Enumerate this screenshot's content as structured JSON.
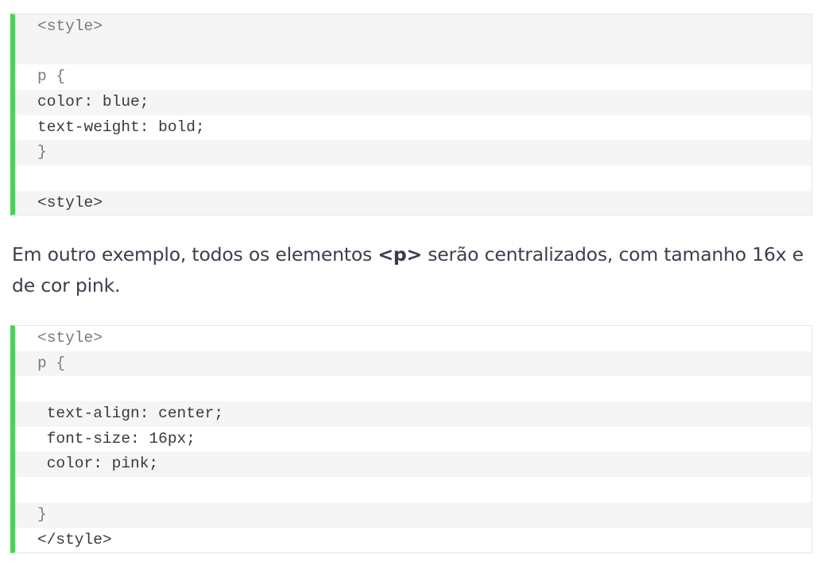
{
  "code_block_1": {
    "lines": [
      "<style>",
      "",
      "p {",
      "color: blue;",
      "text-weight: bold;",
      "}",
      "",
      "<style>"
    ]
  },
  "paragraph": {
    "before": "Em outro exemplo, todos os elementos ",
    "tag": "<p>",
    "after": " serão centralizados, com tamanho 16x e de cor pink."
  },
  "code_block_2": {
    "lines": [
      "<style>",
      "p {",
      "",
      " text-align: center;",
      " font-size: 16px;",
      " color: pink;",
      "",
      "}",
      "</style>"
    ]
  },
  "colors": {
    "accent_bar": "#4cd25a",
    "code_shade": "#f5f5f5",
    "body_text": "#3d3d4e"
  }
}
